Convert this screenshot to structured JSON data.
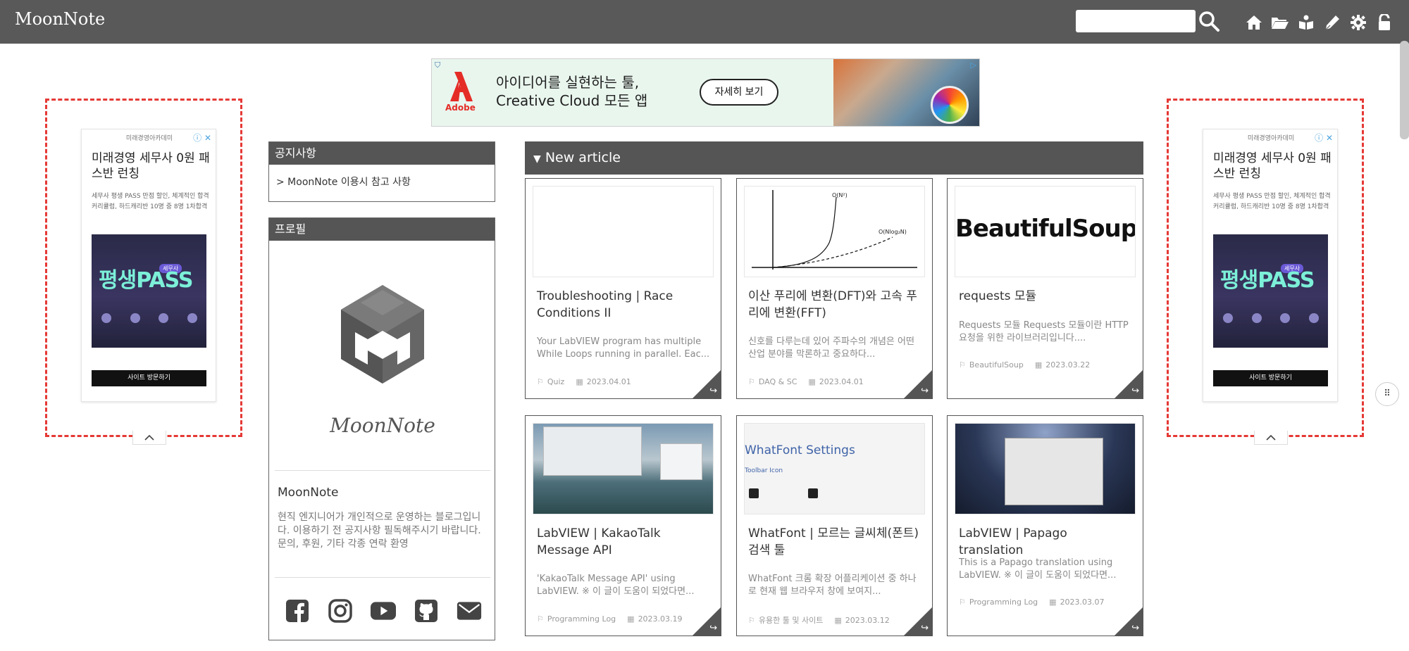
{
  "header": {
    "brand": "MoonNote",
    "search": {
      "value": "",
      "placeholder": ""
    },
    "nav_icons": [
      "home-icon",
      "folder-icon",
      "guestbook-icon",
      "write-icon",
      "settings-icon",
      "lock-icon"
    ]
  },
  "side_ad": {
    "source": "미래경영아카데미",
    "headline": "미래경영 세무사 0원 패스반 런칭",
    "description": "세무사 평생 PASS 만점 할인, 체계적인 합격 커리큘럼, 하드캐리반 10명 중 8명 1차합격",
    "image_title": "평생PASS",
    "image_badge": "세무사",
    "cta": "사이트 방문하기"
  },
  "banner": {
    "brand": "Adobe",
    "line1": "아이디어를 실현하는 툴,",
    "line2": "Creative Cloud 모든 앱",
    "cta": "자세히 보기"
  },
  "notice": {
    "title": "공지사항",
    "items": [
      "> MoonNote 이용시 참고 사항"
    ]
  },
  "profile": {
    "title": "프로필",
    "logo_text": "MoonNote",
    "name": "MoonNote",
    "description": "현직 엔지니어가 개인적으로 운영하는 블로그입니다. 이용하기 전 공지사항 필독해주시기 바랍니다. 문의, 후원, 기타 각종 연락 환영",
    "social": [
      "facebook-icon",
      "instagram-icon",
      "youtube-icon",
      "github-icon",
      "mail-icon"
    ]
  },
  "articles": {
    "heading": "New article",
    "cards": [
      {
        "title": "Troubleshooting | Race Conditions II",
        "excerpt": "Your LabVIEW program has multiple While Loops running in parallel. Eac...",
        "category": "Quiz",
        "date": "2023.04.01",
        "meta_top": true
      },
      {
        "title": "이산 푸리에 변환(DFT)와 고속 푸리에 변환(FFT)",
        "excerpt": "신호를 다루는데 있어 주파수의 개념은 어떤 산업 분야를 막론하고 중요하다...",
        "category": "DAQ & SC",
        "date": "2023.04.01",
        "meta_top": true,
        "thumb_labels": [
          "O(N²)",
          "O(Nlog₂N)"
        ]
      },
      {
        "title": "requests 모듈",
        "excerpt": "Requests 모듈 Requests 모듈이란 HTTP 요청을 위한 라이브러리입니다....",
        "category": "BeautifulSoup",
        "date": "2023.03.22",
        "meta_top": false,
        "thumb_text": "BeautifulSoup"
      },
      {
        "title": "LabVIEW | KakaoTalk Message API",
        "excerpt": "'KakaoTalk Message API' using LabVIEW. ※ 이 글이 도움이 되었다면...",
        "category": "Programming Log",
        "date": "2023.03.19",
        "meta_top": true
      },
      {
        "title": "WhatFont | 모르는 글씨체(폰트) 검색 툴",
        "excerpt": "WhatFont 크롬 확장 어플리케이션 중 하나로 현재 웹 브라우저 창에 보여지...",
        "category": "유용한 툴 및 사이트",
        "date": "2023.03.12",
        "meta_top": true,
        "thumb_title": "WhatFont Settings",
        "thumb_sub": "Toolbar Icon"
      },
      {
        "title": "LabVIEW | Papago translation",
        "excerpt": "This is a Papago translation using LabVIEW. ※ 이 글이 도움이 되었다면...",
        "category": "Programming Log",
        "date": "2023.03.07",
        "meta_top": false
      }
    ]
  }
}
